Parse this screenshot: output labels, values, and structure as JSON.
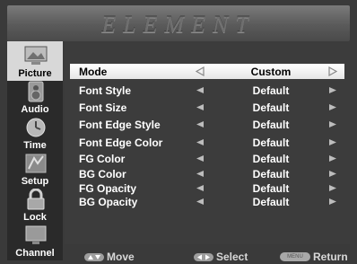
{
  "brand": "ELEMENT",
  "sidebar": {
    "items": [
      {
        "label": "Picture",
        "icon": "picture-icon"
      },
      {
        "label": "Audio",
        "icon": "speaker-icon"
      },
      {
        "label": "Time",
        "icon": "clock-icon"
      },
      {
        "label": "Setup",
        "icon": "setup-icon"
      },
      {
        "label": "Lock",
        "icon": "lock-icon"
      },
      {
        "label": "Channel",
        "icon": "channel-icon"
      }
    ]
  },
  "menu": {
    "rows": [
      {
        "name": "Mode",
        "value": "Custom"
      },
      {
        "name": "Font Style",
        "value": "Default"
      },
      {
        "name": "Font Size",
        "value": "Default"
      },
      {
        "name": "Font Edge Style",
        "value": "Default"
      },
      {
        "name": "Font Edge Color",
        "value": "Default"
      },
      {
        "name": "FG Color",
        "value": "Default"
      },
      {
        "name": "BG Color",
        "value": "Default"
      },
      {
        "name": "FG Opacity",
        "value": "Default"
      },
      {
        "name": "BG Opacity",
        "value": "Default"
      }
    ]
  },
  "footer": {
    "move": "Move",
    "select": "Select",
    "return": "Return",
    "menu_key": "MENU"
  }
}
